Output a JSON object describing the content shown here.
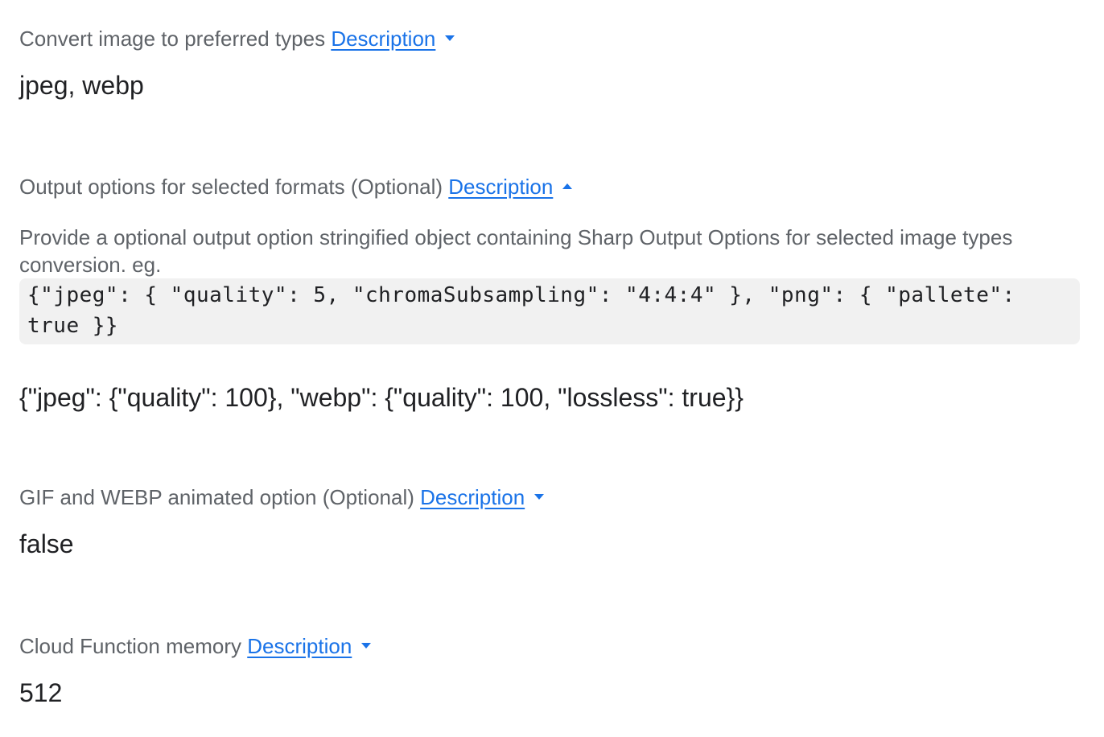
{
  "params": [
    {
      "label": "Convert image to preferred types",
      "description_link": "Description",
      "expanded": false,
      "value": "jpeg, webp"
    },
    {
      "label": "Output options for selected formats (Optional)",
      "description_link": "Description",
      "expanded": true,
      "help_text": "Provide a optional output option stringified object containing Sharp Output Options for selected image types conversion. eg.",
      "example_code": "{\"jpeg\": { \"quality\": 5, \"chromaSubsampling\": \"4:4:4\" }, \"png\": { \"pallete\": true }}",
      "value": "{\"jpeg\": {\"quality\": 100}, \"webp\": {\"quality\": 100, \"lossless\": true}}"
    },
    {
      "label": "GIF and WEBP animated option (Optional)",
      "description_link": "Description",
      "expanded": false,
      "value": "false"
    },
    {
      "label": "Cloud Function memory",
      "description_link": "Description",
      "expanded": false,
      "value": "512"
    }
  ],
  "icons": {
    "collapsed": "caret-down-icon",
    "expanded": "caret-up-icon"
  },
  "colors": {
    "link": "#1a73e8",
    "label": "#5f6368",
    "value": "#202124",
    "code_bg": "#f1f1f1"
  }
}
